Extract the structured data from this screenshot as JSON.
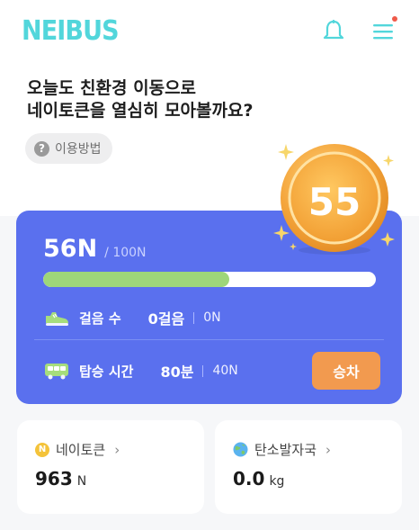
{
  "header": {
    "logo": "NEIBUS",
    "bell_icon": "bell-icon",
    "menu_icon": "hamburger-menu-icon",
    "accent": "#52d6db",
    "notification_dot_color": "#ef5a4a"
  },
  "greeting": {
    "line1": "오늘도 친환경 이동으로",
    "line2": "네이토큰을 열심히 모아볼까요?"
  },
  "howto": {
    "icon": "question-icon",
    "icon_text": "?",
    "label": "이용방법"
  },
  "coin": {
    "value": "55",
    "icon": "coin-icon"
  },
  "progress": {
    "current": "56N",
    "max": "/ 100N",
    "fraction": 0.56,
    "fill_color": "#9ed67a"
  },
  "walk": {
    "icon": "sneaker-icon",
    "label": "걸음 수",
    "value": "0걸음",
    "points": "0N"
  },
  "ride": {
    "icon": "bus-icon",
    "label": "탑승 시간",
    "value": "80분",
    "points": "40N",
    "button_label": "승차",
    "button_color": "#f29a4f"
  },
  "cards": {
    "token": {
      "icon": "n-token-icon",
      "icon_text": "N",
      "title": "네이토큰",
      "chevron": "›",
      "amount": "963",
      "unit": "N"
    },
    "carbon": {
      "icon": "earth-icon",
      "title": "탄소발자국",
      "chevron": "›",
      "amount": "0.0",
      "unit": "kg"
    }
  },
  "colors": {
    "card_blue": "#5a70ee"
  }
}
